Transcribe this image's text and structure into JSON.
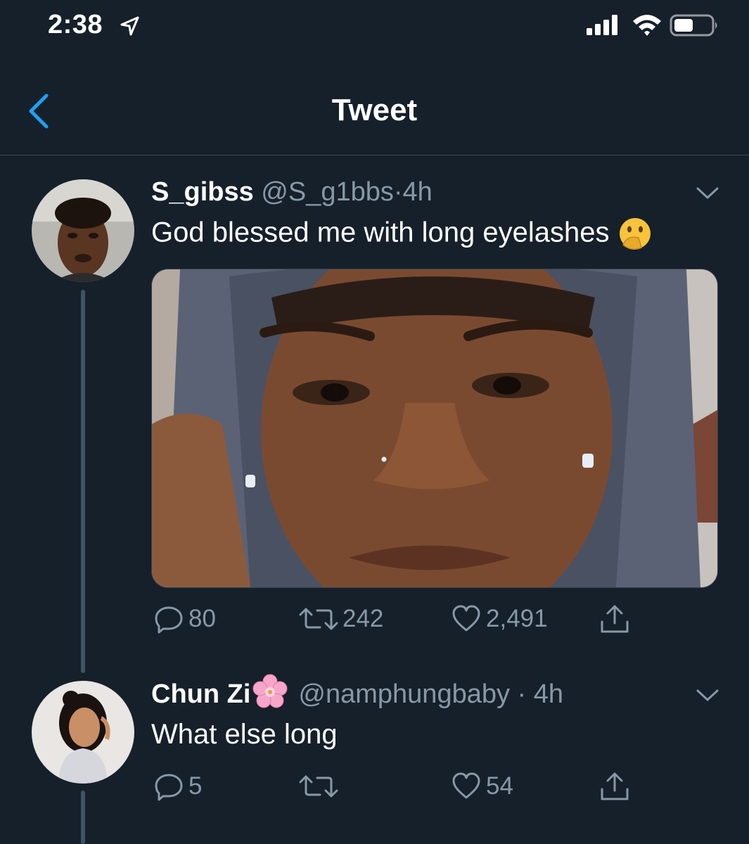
{
  "status": {
    "time": "2:38"
  },
  "nav": {
    "title": "Tweet"
  },
  "tweets": [
    {
      "name": "S_gibss",
      "handle": "@S_g1bbs",
      "separator": "·",
      "age": "4h",
      "text": "God blessed me with long eyelashes",
      "emoji": "face-with-hand-over-mouth",
      "counts": {
        "replies": "80",
        "retweets": "242",
        "likes": "2,491"
      }
    },
    {
      "name": "Chun Zi",
      "name_emoji": "cherry-blossom",
      "handle": "@namphungbaby",
      "separator": "·",
      "age": "4h",
      "text": "What else long",
      "counts": {
        "replies": "5",
        "likes": "54"
      }
    }
  ],
  "colors": {
    "background": "#15202b",
    "accent": "#1da1f2",
    "secondary_text": "#8899a6",
    "divider": "#38444d"
  }
}
